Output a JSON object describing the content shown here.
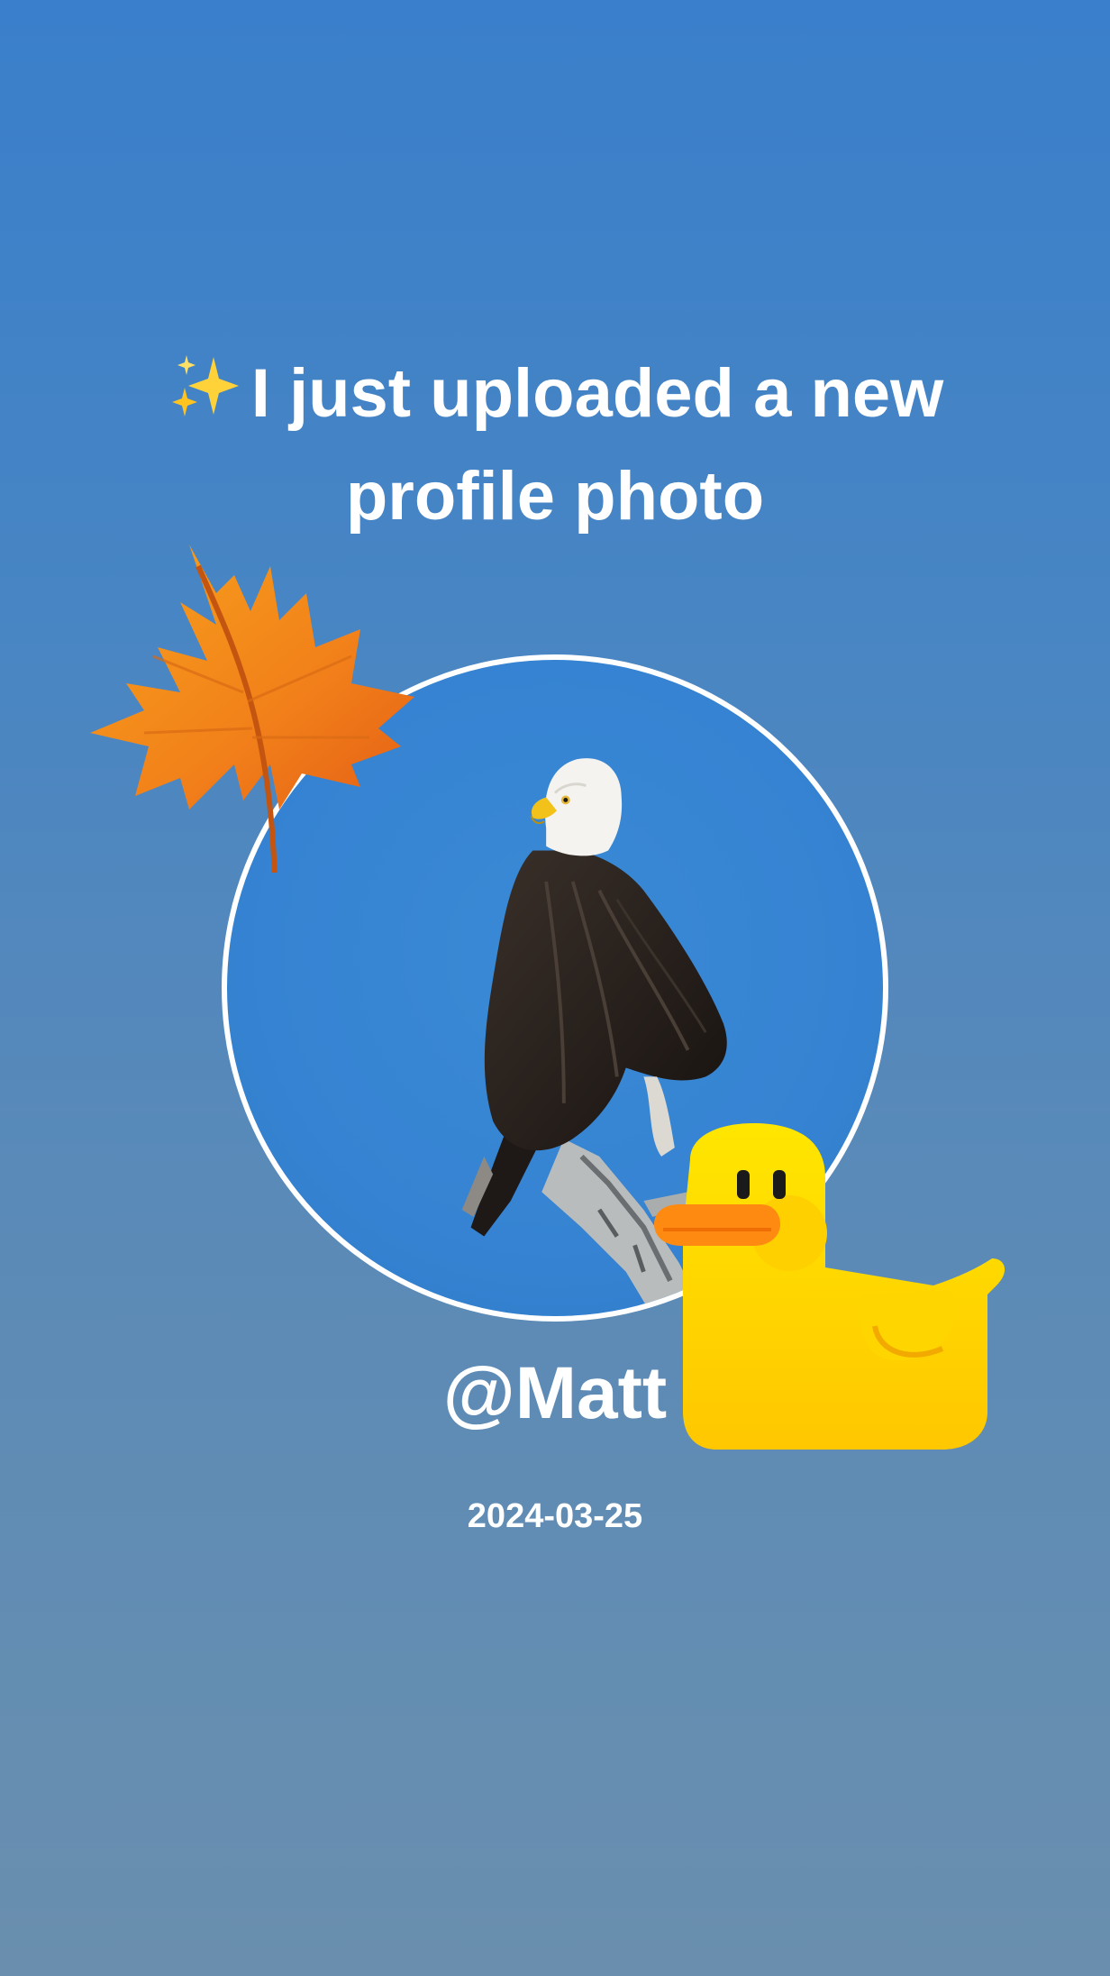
{
  "post": {
    "headline_icon": "sparkles-icon",
    "headline": "I just uploaded a new profile photo",
    "profile_photo": "bald-eagle-on-branch",
    "username": "@Matt",
    "date": "2024-03-25"
  },
  "stickers": [
    "maple-leaf-icon",
    "yellow-duck-icon"
  ],
  "colors": {
    "background_top": "#3a7fcb",
    "background_bottom": "#6a8fae",
    "text": "#ffffff",
    "photo_border": "#ffffff",
    "leaf_orange": "#f07f12",
    "duck_yellow": "#ffd800",
    "duck_beak": "#ff8a12"
  }
}
